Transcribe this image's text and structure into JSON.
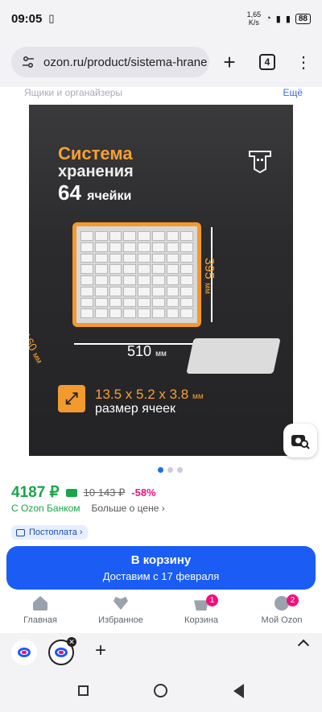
{
  "status_bar": {
    "time": "09:05",
    "speed_value": "1,65",
    "speed_unit": "K/s",
    "battery": "88"
  },
  "browser": {
    "url": "ozon.ru/product/sistema-hrane",
    "tab_count": "4"
  },
  "breadcrumbs": {
    "left": "Ящики и органайзеры",
    "right": "Ещё"
  },
  "hero": {
    "title_line1": "Система",
    "title_line2": "хранения",
    "title_number": "64",
    "title_word": "ячейки",
    "dim_width": "510",
    "dim_height": "395",
    "dim_depth": "160",
    "dim_unit": "мм",
    "cell_size": "13.5 x 5.2 x 3.8",
    "cell_size_unit": "мм",
    "cell_label": "размер ячеек"
  },
  "carousel": {
    "active_index": 0,
    "count": 3
  },
  "price": {
    "current": "4187 ₽",
    "old": "10 143 ₽",
    "discount": "-58%",
    "bank_label": "С Ozon Банком",
    "more_price": "Больше о цене ›"
  },
  "postpay": {
    "label": "Постоплата ›"
  },
  "cart_button": {
    "title": "В корзину",
    "subtitle": "Доставим с 17 февраля"
  },
  "bottom_nav": {
    "items": [
      {
        "label": "Главная",
        "badge": ""
      },
      {
        "label": "Избранное",
        "badge": ""
      },
      {
        "label": "Корзина",
        "badge": "1"
      },
      {
        "label": "Мой Ozon",
        "badge": "2"
      }
    ]
  },
  "colors": {
    "accent_blue": "#1a5cf4",
    "price_green": "#1aa54a",
    "discount_pink": "#f1117e",
    "hero_orange": "#f39a2e"
  }
}
